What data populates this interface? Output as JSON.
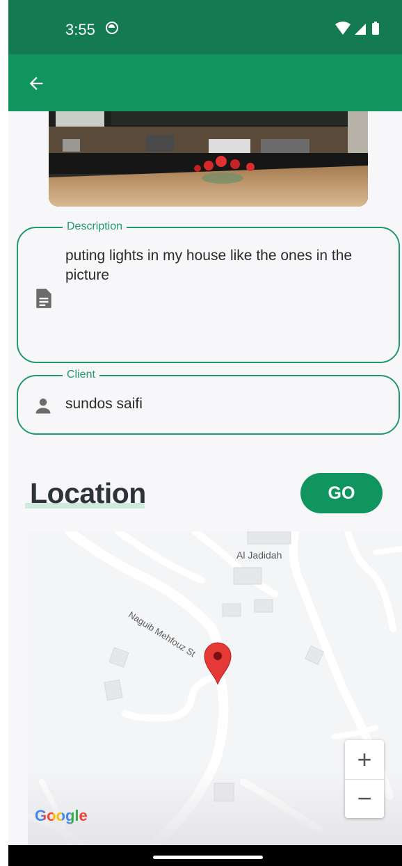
{
  "status_bar": {
    "time": "3:55"
  },
  "app_bar": {
    "back_icon": "arrow-left-icon"
  },
  "description": {
    "label": "Description",
    "value": "puting lights in my house like the ones in the picture",
    "icon": "document-icon"
  },
  "client": {
    "label": "Client",
    "value": "sundos saifi",
    "icon": "person-icon"
  },
  "location": {
    "title": "Location",
    "go_label": "GO"
  },
  "map": {
    "labels": {
      "area": "Al Jadidah",
      "street": "Naguib Mehfouz St"
    },
    "zoom_in": "+",
    "zoom_out": "−",
    "attribution": "Google"
  },
  "colors": {
    "status_bar": "#137a52",
    "app_bar": "#11955f",
    "accent": "#1f9a6c",
    "pin": "#e53935"
  }
}
